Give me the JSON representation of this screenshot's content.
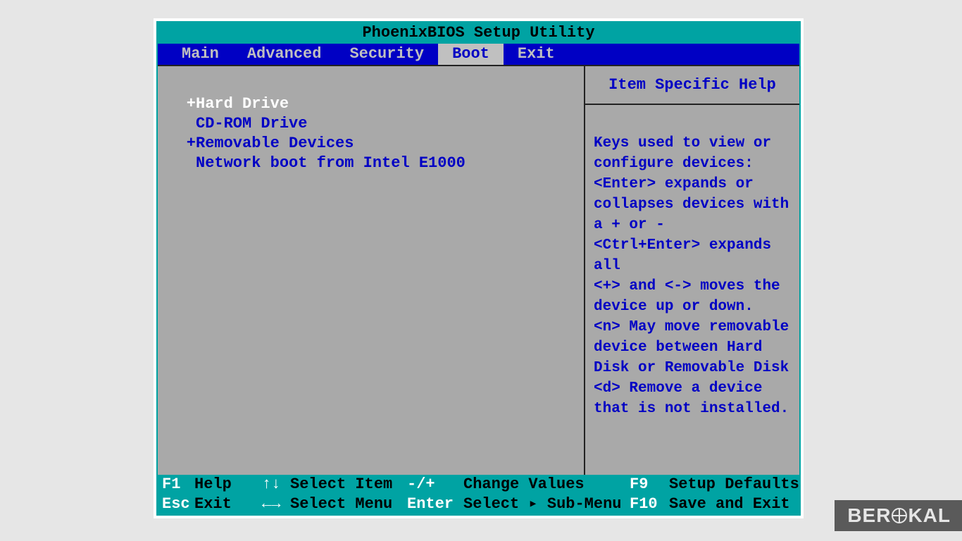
{
  "title": "PhoenixBIOS Setup Utility",
  "tabs": {
    "main": "Main",
    "advanced": "Advanced",
    "security": "Security",
    "boot": "Boot",
    "exit": "Exit",
    "active": "boot"
  },
  "boot_order": {
    "item0": {
      "prefix": "+",
      "label": "Hard Drive",
      "selected": true
    },
    "item1": {
      "prefix": " ",
      "label": "CD-ROM Drive",
      "selected": false
    },
    "item2": {
      "prefix": "+",
      "label": "Removable Devices",
      "selected": false
    },
    "item3": {
      "prefix": " ",
      "label": "Network boot from Intel E1000",
      "selected": false
    }
  },
  "help": {
    "title": "Item Specific Help",
    "body_lines": {
      "l0": "Keys used to view or",
      "l1": "configure devices:",
      "l2": "<Enter> expands or",
      "l3": "collapses devices with",
      "l4": "a + or -",
      "l5": "<Ctrl+Enter> expands",
      "l6": "all",
      "l7": "<+> and <-> moves the",
      "l8": "device up or down.",
      "l9": "<n> May move removable",
      "l10": "device between Hard",
      "l11": "Disk or Removable Disk",
      "l12": "<d> Remove a device",
      "l13": "that is not installed."
    }
  },
  "footer": {
    "row1": {
      "k1": "F1",
      "l1": "Help",
      "k2": "↑↓",
      "l2": "Select Item",
      "k3": "-/+",
      "l3": "Change Values",
      "k4": "F9",
      "l4": "Setup Defaults"
    },
    "row2": {
      "k1": "Esc",
      "l1": "Exit",
      "k2": "←→",
      "l2": "Select Menu",
      "k3": "Enter",
      "l3": "Select ▸ Sub-Menu",
      "k4": "F10",
      "l4": "Save and Exit"
    }
  },
  "watermark": {
    "pre": "BER",
    "post": "KAL"
  }
}
